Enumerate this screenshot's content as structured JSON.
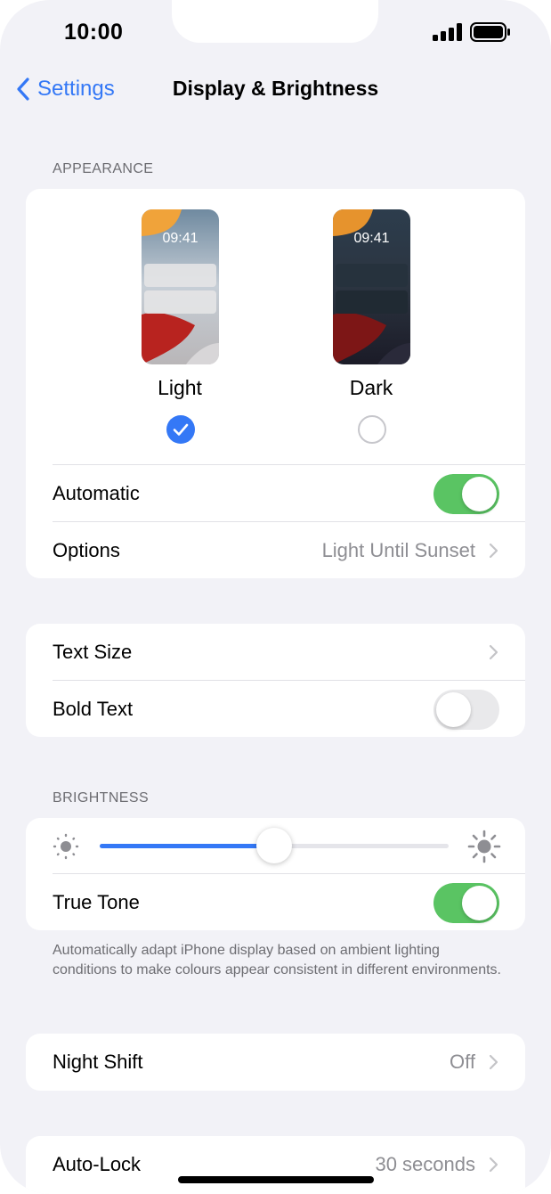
{
  "status_bar": {
    "time": "10:00"
  },
  "nav": {
    "back_label": "Settings",
    "title": "Display & Brightness"
  },
  "appearance": {
    "header": "APPEARANCE",
    "options": [
      {
        "label": "Light",
        "preview_time": "09:41",
        "selected": true
      },
      {
        "label": "Dark",
        "preview_time": "09:41",
        "selected": false
      }
    ],
    "automatic": {
      "label": "Automatic",
      "on": true
    },
    "options_row": {
      "label": "Options",
      "value": "Light Until Sunset"
    }
  },
  "text": {
    "text_size": {
      "label": "Text Size"
    },
    "bold_text": {
      "label": "Bold Text",
      "on": false
    }
  },
  "brightness": {
    "header": "BRIGHTNESS",
    "level": 0.5,
    "true_tone": {
      "label": "True Tone",
      "on": true
    },
    "footnote": "Automatically adapt iPhone display based on ambient lighting conditions to make colours appear consistent in different environments."
  },
  "night_shift": {
    "label": "Night Shift",
    "value": "Off"
  },
  "auto_lock": {
    "label": "Auto-Lock",
    "value": "30 seconds"
  },
  "colors": {
    "accent": "#3478f6",
    "toggle_on": "#5ac463",
    "background": "#f2f2f7"
  }
}
